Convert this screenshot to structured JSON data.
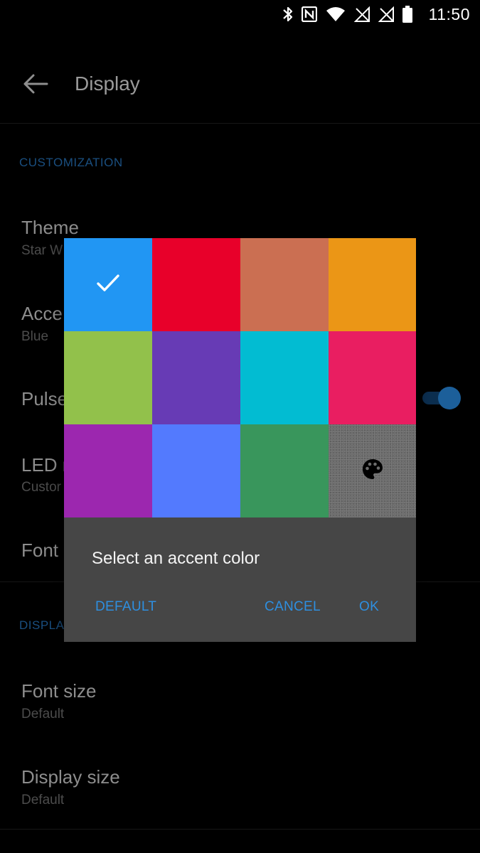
{
  "status_bar": {
    "time": "11:50",
    "icons": [
      "bluetooth-icon",
      "nfc-icon",
      "wifi-icon",
      "no-sim-icon",
      "no-sim-icon",
      "battery-icon"
    ]
  },
  "app_bar": {
    "title": "Display",
    "back_icon": "arrow-left-icon"
  },
  "sections": [
    {
      "header": "CUSTOMIZATION",
      "items": [
        {
          "title": "Theme",
          "summary": "Star W"
        },
        {
          "title": "Acce",
          "summary": "Blue"
        },
        {
          "title": "Pulse",
          "toggle": true
        },
        {
          "title": "LED n",
          "summary": "Custor"
        },
        {
          "title": "Font"
        }
      ]
    },
    {
      "header": "DISPLA",
      "items": [
        {
          "title": "Font size",
          "summary": "Default"
        },
        {
          "title": "Display size",
          "summary": "Default"
        }
      ]
    }
  ],
  "dialog": {
    "title": "Select an accent color",
    "buttons": {
      "default": "DEFAULT",
      "cancel": "CANCEL",
      "ok": "OK"
    },
    "swatches": [
      {
        "color": "#2196f3",
        "selected": true,
        "icon": "check-icon"
      },
      {
        "color": "#e8002a"
      },
      {
        "color": "#cb6f52"
      },
      {
        "color": "#eb9616"
      },
      {
        "color": "#92c14b"
      },
      {
        "color": "#673bb5"
      },
      {
        "color": "#02bcd2"
      },
      {
        "color": "#e91e61"
      },
      {
        "color": "#9c27af"
      },
      {
        "color": "#537afe"
      },
      {
        "color": "#39965c"
      },
      {
        "color": "#6c6c6c",
        "custom": true,
        "icon": "palette-icon"
      }
    ]
  },
  "colors": {
    "background": "#000000",
    "dialog": "#464646",
    "accent_text": "#2e8fe0",
    "section_header": "#1a4f80"
  }
}
